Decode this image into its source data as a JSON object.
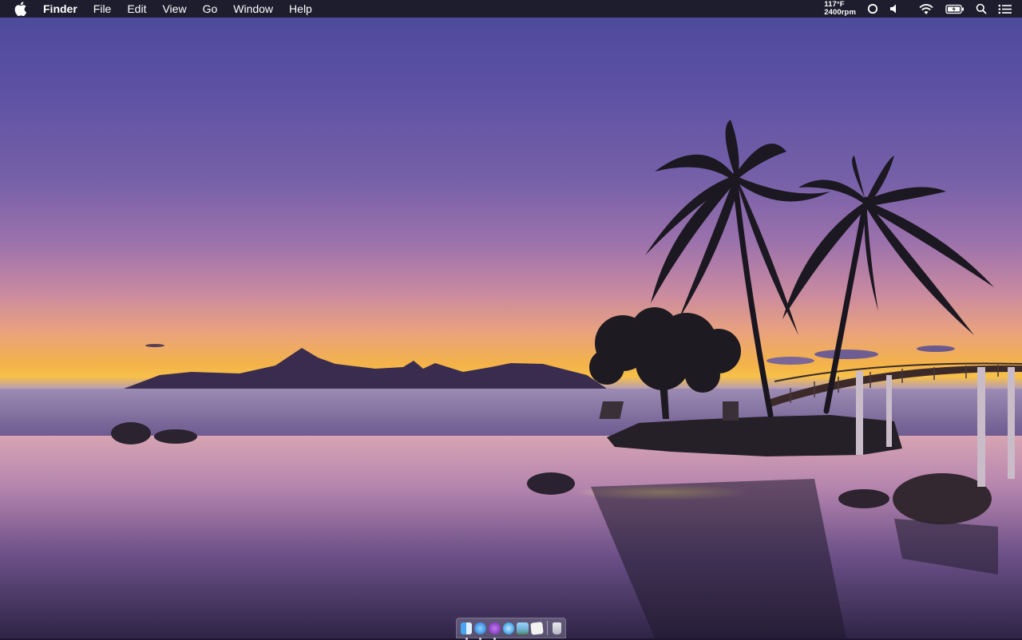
{
  "menubar": {
    "app_name": "Finder",
    "items": [
      "File",
      "Edit",
      "View",
      "Go",
      "Window",
      "Help"
    ],
    "status": {
      "temperature": "117°F",
      "fan": "2400rpm"
    },
    "tray_icons": [
      "circle-status-icon",
      "volume-icon",
      "wifi-icon",
      "battery-charging-icon",
      "spotlight-search-icon",
      "notification-center-icon"
    ]
  },
  "dock": {
    "apps": [
      {
        "name": "Finder",
        "icon": "finder-icon",
        "running": true,
        "color": "#4aa3f0"
      },
      {
        "name": "Safari",
        "icon": "safari-icon",
        "running": true,
        "color": "#3b8de0"
      },
      {
        "name": "Podcasts",
        "icon": "podcasts-icon",
        "running": true,
        "color": "#8a3fc6"
      },
      {
        "name": "iTunes",
        "icon": "itunes-icon",
        "running": false,
        "color": "#3aa0e8"
      },
      {
        "name": "Preview",
        "icon": "preview-icon",
        "running": false,
        "color": "#6fb0d8"
      },
      {
        "name": "TextEdit",
        "icon": "textedit-icon",
        "running": false,
        "color": "#f2f2f2"
      }
    ],
    "trash": {
      "name": "Trash",
      "icon": "trash-icon"
    }
  },
  "colors": {
    "menubar_bg": "#1e1d2e",
    "sky_top": "#4b4a9a",
    "horizon": "#f6c04a",
    "water": "#6a4f86"
  }
}
